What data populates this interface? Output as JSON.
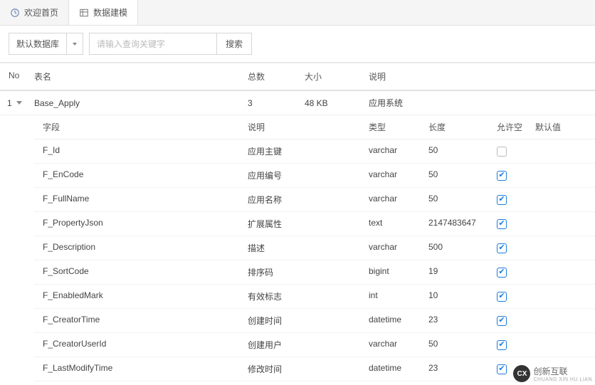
{
  "tabs": [
    {
      "label": "欢迎首页",
      "icon": "dashboard-icon"
    },
    {
      "label": "数据建模",
      "icon": "table-icon"
    }
  ],
  "toolbar": {
    "db_label": "默认数据库",
    "search_placeholder": "请输入查询关键字",
    "search_btn": "搜索"
  },
  "columns": {
    "no": "No",
    "name": "表名",
    "total": "总数",
    "size": "大小",
    "desc": "说明"
  },
  "row": {
    "no": "1",
    "name": "Base_Apply",
    "total": "3",
    "size": "48 KB",
    "desc": "应用系统"
  },
  "sub_columns": {
    "field": "字段",
    "desc": "说明",
    "type": "类型",
    "len": "长度",
    "null": "允许空",
    "def": "默认值"
  },
  "fields": [
    {
      "field": "F_Id",
      "desc": "应用主键",
      "type": "varchar",
      "len": "50",
      "null": false
    },
    {
      "field": "F_EnCode",
      "desc": "应用编号",
      "type": "varchar",
      "len": "50",
      "null": true
    },
    {
      "field": "F_FullName",
      "desc": "应用名称",
      "type": "varchar",
      "len": "50",
      "null": true
    },
    {
      "field": "F_PropertyJson",
      "desc": "扩展属性",
      "type": "text",
      "len": "2147483647",
      "null": true
    },
    {
      "field": "F_Description",
      "desc": "描述",
      "type": "varchar",
      "len": "500",
      "null": true
    },
    {
      "field": "F_SortCode",
      "desc": "排序码",
      "type": "bigint",
      "len": "19",
      "null": true
    },
    {
      "field": "F_EnabledMark",
      "desc": "有效标志",
      "type": "int",
      "len": "10",
      "null": true
    },
    {
      "field": "F_CreatorTime",
      "desc": "创建时间",
      "type": "datetime",
      "len": "23",
      "null": true
    },
    {
      "field": "F_CreatorUserId",
      "desc": "创建用户",
      "type": "varchar",
      "len": "50",
      "null": true
    },
    {
      "field": "F_LastModifyTime",
      "desc": "修改时间",
      "type": "datetime",
      "len": "23",
      "null": true
    }
  ],
  "watermark": {
    "brand": "创新互联",
    "sub": "CHUANG XIN HU LIAN"
  }
}
